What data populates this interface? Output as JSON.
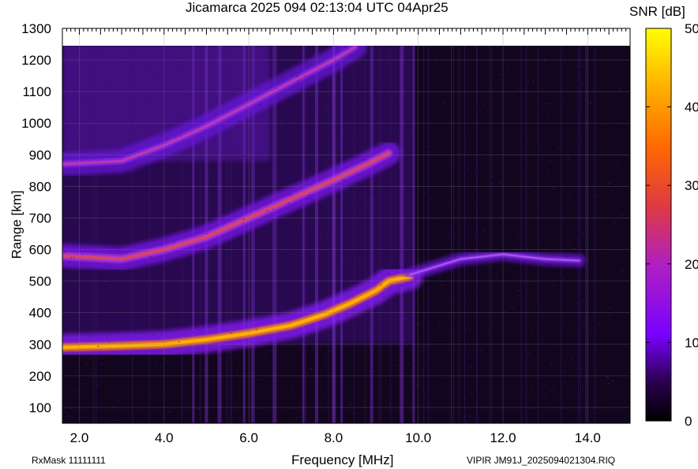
{
  "header": {
    "title": "Jicamarca 2025 094 02:13:04 UTC       04Apr25",
    "colorbar_label": "SNR [dB]"
  },
  "footer": {
    "rxmask": "RxMask 11111111",
    "filename": "VIPIR  JM91J_2025094021304.RIQ"
  },
  "chart_data": {
    "type": "heatmap",
    "title": "Jicamarca 2025 094 02:13:04 UTC       04Apr25",
    "xlabel": "Frequency [MHz]",
    "ylabel": "Range [km]",
    "xlim": [
      1.6,
      15.0
    ],
    "ylim": [
      50,
      1300
    ],
    "x_ticks": [
      "2.0",
      "4.0",
      "6.0",
      "8.0",
      "10.0",
      "12.0",
      "14.0"
    ],
    "y_ticks": [
      "100",
      "200",
      "300",
      "400",
      "500",
      "600",
      "700",
      "800",
      "900",
      "1000",
      "1100",
      "1200",
      "1300"
    ],
    "colorbar": {
      "label": "SNR [dB]",
      "min": 0,
      "max": 50,
      "ticks": [
        "0",
        "10",
        "20",
        "30",
        "40",
        "50"
      ]
    },
    "data_extent": {
      "x": [
        1.6,
        15.0
      ],
      "y": [
        50,
        1245
      ]
    },
    "traces": [
      {
        "feature": "F-layer O/X echo",
        "freq_mhz": [
          1.6,
          3.0,
          4.0,
          5.0,
          6.0,
          7.0,
          7.8,
          8.4,
          9.0,
          9.3,
          9.8
        ],
        "range_km": [
          290,
          295,
          300,
          315,
          335,
          360,
          395,
          430,
          470,
          500,
          515
        ]
      },
      {
        "feature": "second hop",
        "freq_mhz": [
          1.6,
          3.0,
          4.0,
          5.0,
          6.0,
          7.0,
          8.0,
          8.8,
          9.3
        ],
        "range_km": [
          580,
          570,
          600,
          640,
          700,
          760,
          820,
          870,
          905
        ]
      },
      {
        "feature": "third hop",
        "freq_mhz": [
          1.6,
          3.0,
          4.0,
          5.0,
          6.0,
          7.0,
          8.0,
          8.5
        ],
        "range_km": [
          870,
          880,
          930,
          990,
          1060,
          1130,
          1200,
          1240
        ]
      },
      {
        "feature": "sporadic echo",
        "freq_mhz": [
          9.8,
          11.0,
          12.0,
          13.0,
          13.8
        ],
        "range_km": [
          520,
          570,
          585,
          570,
          565
        ]
      }
    ],
    "strong_interference_freqs_mhz": [
      4.7,
      5.0,
      5.3,
      5.9,
      6.1,
      6.6,
      7.3,
      7.6,
      8.0,
      8.2,
      8.9,
      9.6,
      9.9
    ],
    "grid": true
  }
}
